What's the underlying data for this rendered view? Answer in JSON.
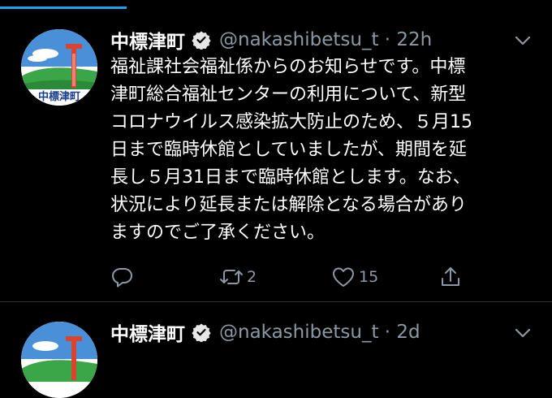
{
  "colors": {
    "background": "#000000",
    "accent": "#1da1f2",
    "muted": "#8b98a5",
    "divider": "#2f3336",
    "verified": "#e6e6e6"
  },
  "progress": {
    "fraction": 0.23
  },
  "tweets": [
    {
      "name": "中標津町",
      "handle": "@nakashibetsu_t · 22h",
      "avatar_text": "中標津町",
      "verified_icon": "verified-badge-icon",
      "text": "福祉課社会福祉係からのお知らせです。中標\n津町総合福祉センターの利用について、新型\nコロナウイルス感染拡大防止のため、５月15\n日まで臨時休館としていましたが、期間を延\n長し５月31日まで臨時休館とします。なお、\n状況により延長または解除となる場合があり\nますのでご了承ください。",
      "actions": {
        "reply_icon": "reply-icon",
        "retweet_count": "2",
        "like_count": "15",
        "share_icon": "share-icon"
      }
    },
    {
      "name": "中標津町",
      "handle": "@nakashibetsu_t · 2d",
      "verified_icon": "verified-badge-icon"
    }
  ]
}
